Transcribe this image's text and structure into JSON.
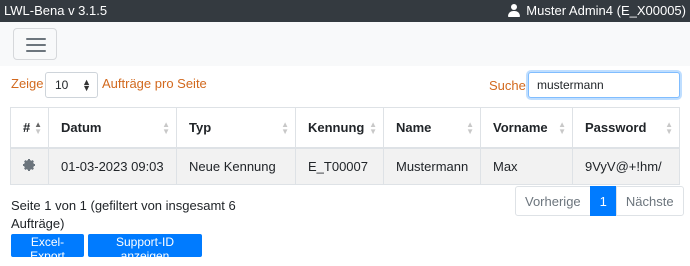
{
  "app": {
    "title": "LWL-Bena v 3.1.5",
    "user": "Muster Admin4 (E_X00005)"
  },
  "length": {
    "prefix": "Zeige",
    "value": "10",
    "suffix": "Aufträge pro Seite"
  },
  "search": {
    "label": "Suche",
    "value": "mustermann"
  },
  "table": {
    "columns": [
      "#",
      "Datum",
      "Typ",
      "Kennung",
      "Name",
      "Vorname",
      "Password"
    ],
    "rows": [
      {
        "datum": "01-03-2023 09:03",
        "typ": "Neue Kennung",
        "kennung": "E_T00007",
        "name": "Mustermann",
        "vorname": "Max",
        "password": "9VyV@+!hm/"
      }
    ]
  },
  "info": "Seite 1 von 1 (gefiltert von insgesamt 6 Aufträge)",
  "pagination": {
    "prev": "Vorherige",
    "current": "1",
    "next": "Nächste"
  },
  "buttons": {
    "excel": "Excel-Export",
    "support": "Support-ID anzeigen"
  }
}
